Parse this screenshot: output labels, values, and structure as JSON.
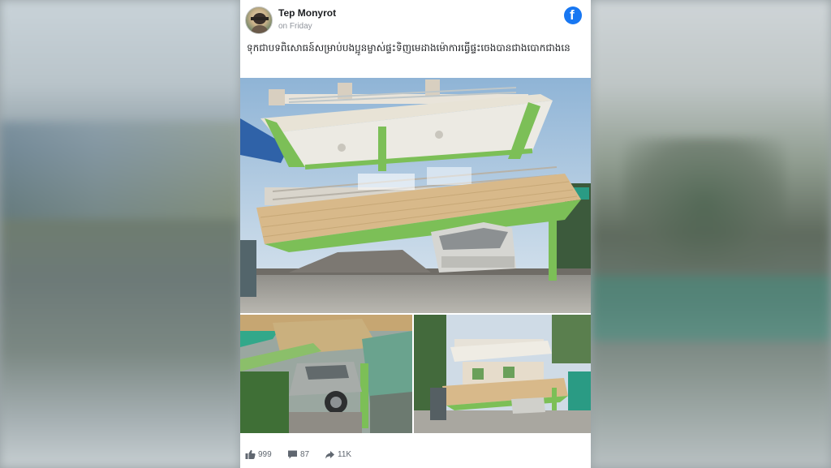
{
  "post": {
    "author": "Tep Monyrot",
    "time": "on Friday",
    "caption": "ទុកជាបទពិសោធន៍សម្រាប់បងប្អូនម្ចាស់ផ្ទះទិញមេដាងម៉ោការធ្វើផ្ទះចេងបានជាងបោកជាងនេ",
    "logo": "facebook-icon",
    "photos": [
      {
        "name": "collapsed-house-main-photo"
      },
      {
        "name": "crushed-car-closeup-photo"
      },
      {
        "name": "collapsed-house-wide-photo"
      }
    ]
  },
  "footer": {
    "likes": "999",
    "comments": "87",
    "shares": "11K"
  },
  "colors": {
    "facebook_blue": "#1877f2",
    "card_bg": "#ffffff",
    "name_text": "#1c1e21",
    "meta_text": "#90949c"
  }
}
